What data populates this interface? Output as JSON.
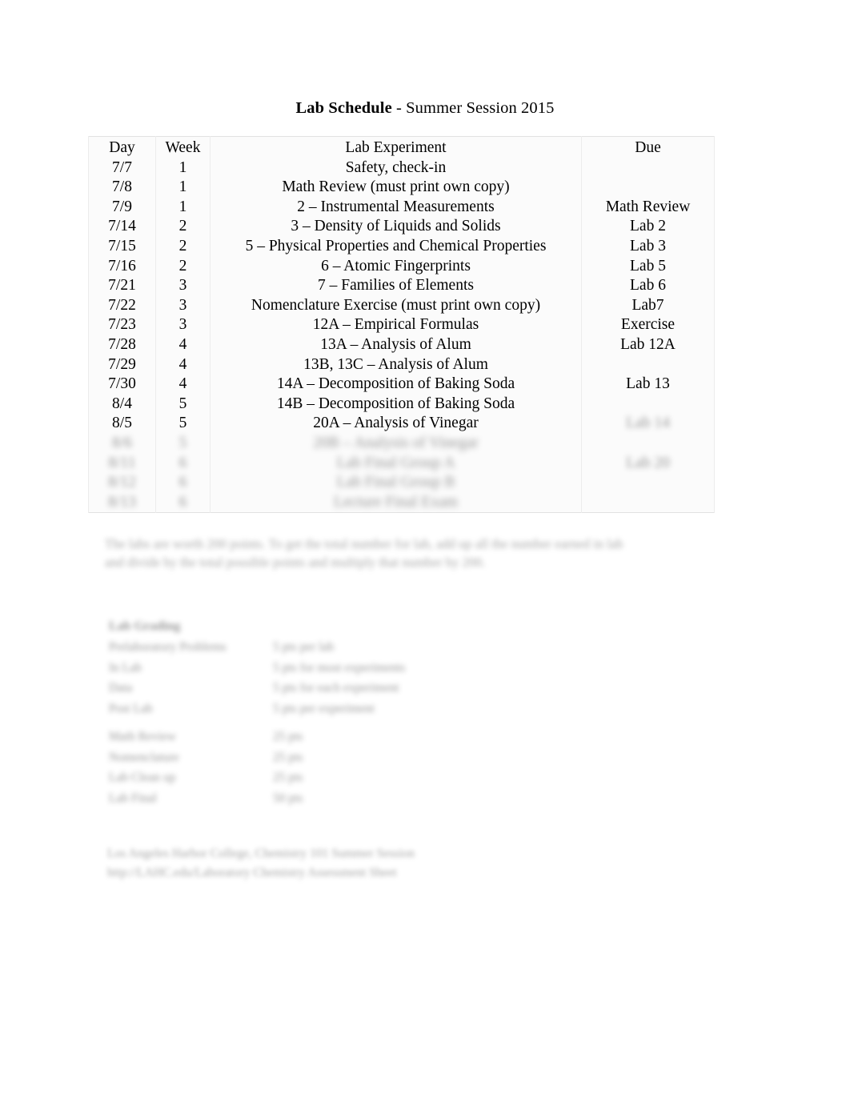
{
  "document": {
    "title_strong": "Lab Schedule",
    "title_separator": " - ",
    "title_rest": "Summer Session 2015"
  },
  "schedule_table": {
    "name": "lab-schedule-table",
    "columns": [
      "Day",
      "Week",
      "Lab Experiment",
      "Due"
    ],
    "rows": [
      {
        "day": "7/7",
        "week": "1",
        "experiment": "Safety, check-in",
        "due": "",
        "legible": true
      },
      {
        "day": "7/8",
        "week": "1",
        "experiment": "Math Review (must print own copy)",
        "due": "",
        "legible": true
      },
      {
        "day": "7/9",
        "week": "1",
        "experiment": "2 – Instrumental Measurements",
        "due": "Math Review",
        "legible": true
      },
      {
        "day": "7/14",
        "week": "2",
        "experiment": "3 – Density of Liquids and Solids",
        "due": "Lab 2",
        "legible": true
      },
      {
        "day": "7/15",
        "week": "2",
        "experiment": "5 – Physical Properties and Chemical Properties",
        "due": "Lab 3",
        "legible": true
      },
      {
        "day": "7/16",
        "week": "2",
        "experiment": "6 – Atomic Fingerprints",
        "due": "Lab 5",
        "legible": true
      },
      {
        "day": "7/21",
        "week": "3",
        "experiment": "7 – Families of Elements",
        "due": "Lab 6",
        "legible": true
      },
      {
        "day": "7/22",
        "week": "3",
        "experiment": "Nomenclature Exercise (must print own copy)",
        "due": "Lab7",
        "legible": true
      },
      {
        "day": "7/23",
        "week": "3",
        "experiment": "12A – Empirical Formulas",
        "due": "Exercise",
        "legible": true
      },
      {
        "day": "7/28",
        "week": "4",
        "experiment": "13A – Analysis of Alum",
        "due": "Lab 12A",
        "legible": true
      },
      {
        "day": "7/29",
        "week": "4",
        "experiment": "13B, 13C – Analysis of Alum",
        "due": "",
        "legible": true
      },
      {
        "day": "7/30",
        "week": "4",
        "experiment": "14A – Decomposition of Baking Soda",
        "due": "Lab 13",
        "legible": true
      },
      {
        "day": "8/4",
        "week": "5",
        "experiment": "14B – Decomposition of Baking Soda",
        "due": "",
        "legible": true
      },
      {
        "day": "8/5",
        "week": "5",
        "experiment": "20A – Analysis of Vinegar",
        "due": "Lab 14",
        "legible": true,
        "due_illegible": true
      },
      {
        "day": "8/6",
        "week": "5",
        "experiment": "20B – Analysis of Vinegar",
        "due": "",
        "legible": false
      },
      {
        "day": "8/11",
        "week": "6",
        "experiment": "Lab Final Group A",
        "due": "Lab 20",
        "legible": false
      },
      {
        "day": "8/12",
        "week": "6",
        "experiment": "Lab Final Group B",
        "due": "",
        "legible": false
      },
      {
        "day": "8/13",
        "week": "6",
        "experiment": "Lecture Final Exam",
        "due": "",
        "legible": false
      }
    ]
  },
  "body_paragraph": {
    "line1": "The labs are worth 200 points.  To get the total number for lab, add up all the number earned in lab",
    "line2": "and divide by the total possible points and multiply that number by 200."
  },
  "grading": {
    "title": "Lab Grading",
    "rows": [
      {
        "item": "Prelaboratory Problems",
        "value": "5 pts per lab"
      },
      {
        "item": "In Lab",
        "value": "5 pts for most experiments"
      },
      {
        "item": "Data",
        "value": "5 pts for each experiment"
      },
      {
        "item": "Post Lab",
        "value": "5 pts per experiment"
      },
      {
        "item": "",
        "value": ""
      },
      {
        "item": "Math Review",
        "value": "25 pts"
      },
      {
        "item": "Nomenclature",
        "value": "25 pts"
      },
      {
        "item": "Lab Clean up",
        "value": "25 pts"
      },
      {
        "item": "Lab Final",
        "value": "50 pts"
      }
    ]
  },
  "footer": {
    "line1": "Los Angeles Harbor College, Chemistry 101 Summer Session",
    "line2": "http://LAHC.edu/Laboratory Chemistry Assessment Sheet"
  }
}
